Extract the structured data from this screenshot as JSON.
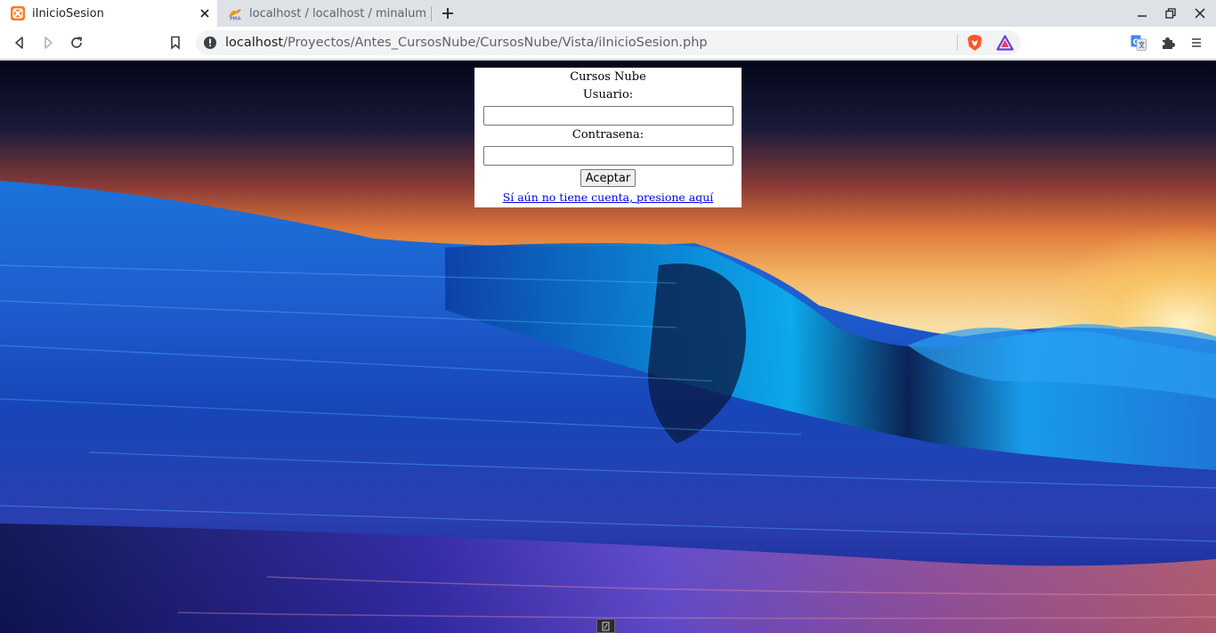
{
  "browser": {
    "tabs": [
      {
        "title": "iInicioSesion",
        "favicon": "xampp-icon",
        "active": true
      },
      {
        "title": "localhost / localhost / minalum",
        "favicon": "phpmyadmin-icon",
        "active": false
      }
    ],
    "address": {
      "host": "localhost",
      "path": "/Proyectos/Antes_CursosNube/CursosNube/Vista/iInicioSesion.php"
    },
    "accent_color": "#e8652b"
  },
  "login": {
    "heading": "Cursos Nube",
    "user_label": "Usuario:",
    "user_value": "",
    "password_label": "Contrasena:",
    "password_value": "",
    "submit_label": "Aceptar",
    "signup_link": "Sí aún no tiene cuenta, presione aquí"
  }
}
